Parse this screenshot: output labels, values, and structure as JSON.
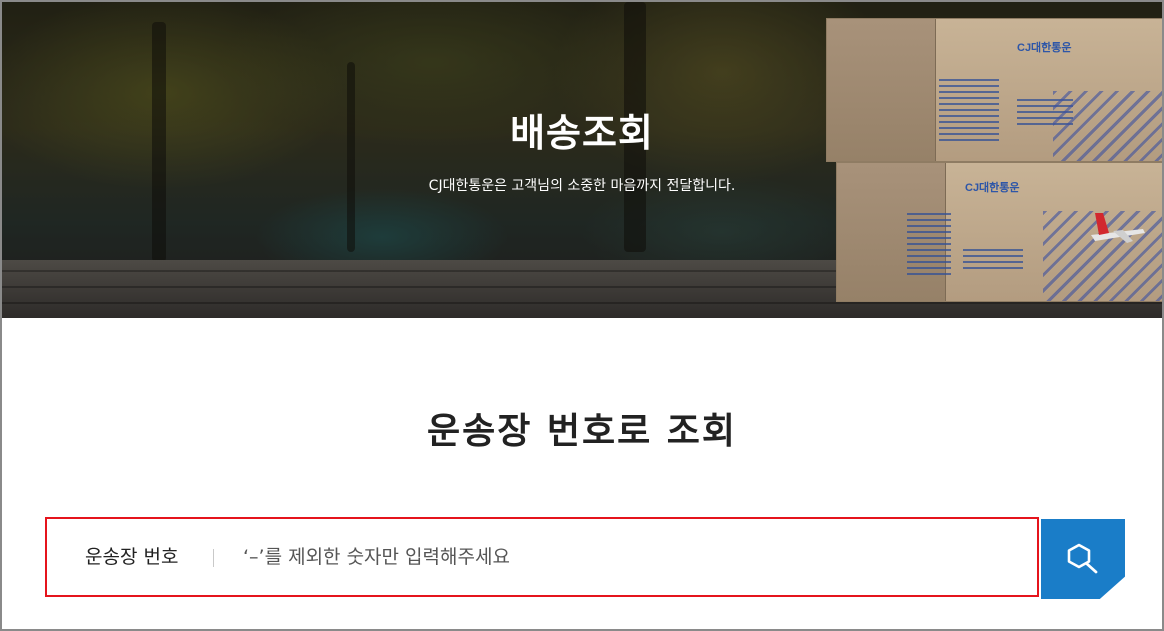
{
  "hero": {
    "title": "배송조회",
    "subtitle": "CJ대한통운은 고객님의 소중한 마음까지 전달합니다.",
    "box_logo": "CJ대한통운"
  },
  "tracking": {
    "heading": "운송장 번호로 조회",
    "field_label": "운송장 번호",
    "placeholder": "‘–’를 제외한 숫자만 입력해주세요",
    "value": "",
    "search_icon": "search-icon"
  },
  "colors": {
    "highlight_border": "#e5141c",
    "search_button": "#1a7dc8",
    "heading_text": "#222222"
  }
}
